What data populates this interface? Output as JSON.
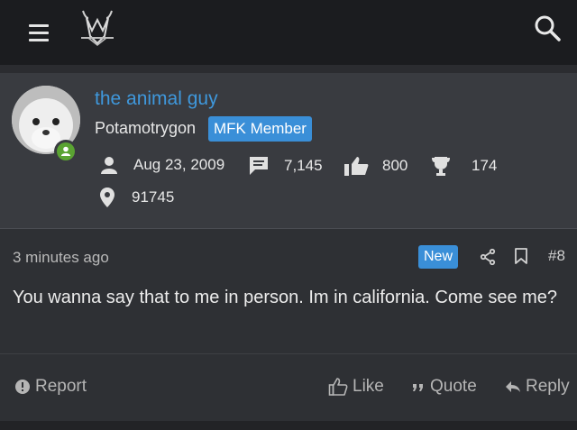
{
  "header": {
    "menu_icon": "hamburger-menu-icon",
    "logo_icon": "forum-logo-m-icon",
    "search_icon": "search-icon"
  },
  "user": {
    "name": "the animal guy",
    "title": "Potamotrygon",
    "badge": "MFK Member",
    "avatar_icon": "seal-avatar",
    "status_icon": "online-status-icon",
    "joined": "Aug 23, 2009",
    "messages": "7,145",
    "reactions": "800",
    "points": "174",
    "location": "91745"
  },
  "post": {
    "time": "3 minutes ago",
    "new_label": "New",
    "number": "#8",
    "text": "You wanna say that to me in person. Im in california. Come see me?"
  },
  "actions": {
    "report": "Report",
    "like": "Like",
    "quote": "Quote",
    "reply": "Reply"
  },
  "colors": {
    "accent": "#3a8fd8",
    "username": "#3f98dc",
    "online": "#5aa332"
  }
}
